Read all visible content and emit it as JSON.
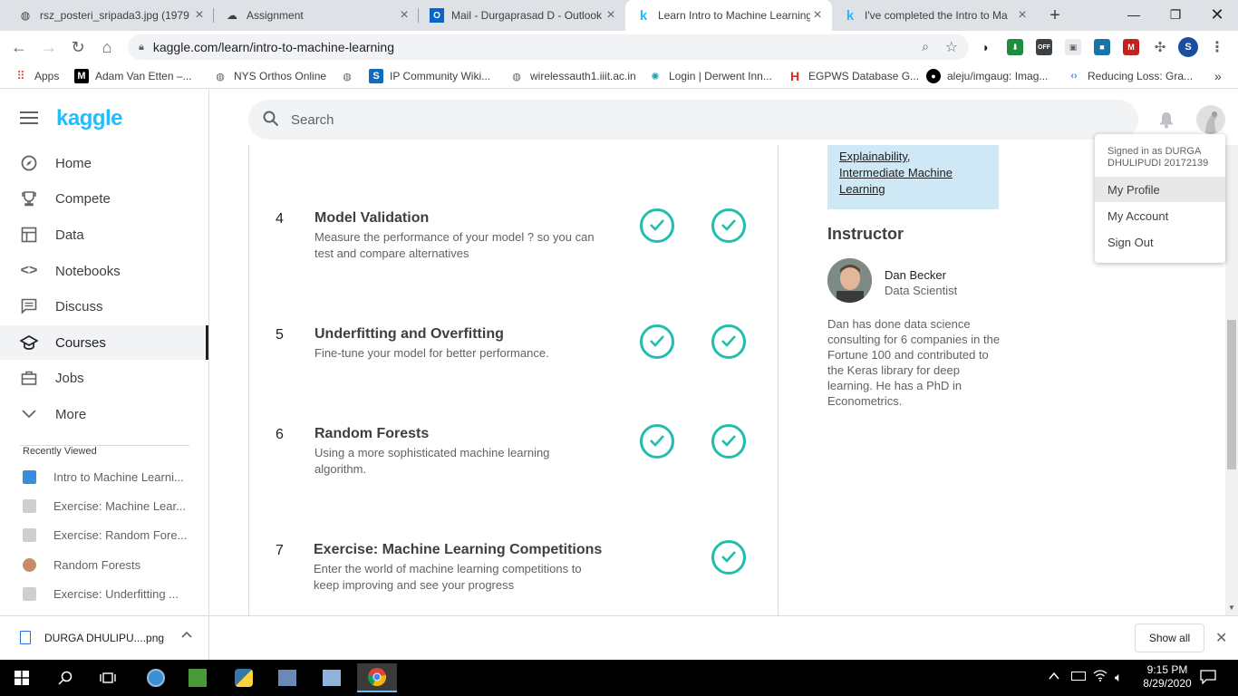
{
  "browser": {
    "tabs": [
      {
        "title": "rsz_posteri_sripada3.jpg (1979",
        "icon": "globe-icon"
      },
      {
        "title": "Assignment",
        "icon": "cloud-icon"
      },
      {
        "title": "Mail - Durgaprasad D - Outlook",
        "icon": "outlook-icon"
      },
      {
        "title": "Learn Intro to Machine Learning",
        "icon": "kaggle-k-icon",
        "active": true
      },
      {
        "title": "I've completed the Intro to Ma",
        "icon": "kaggle-k-icon"
      }
    ],
    "new_tab": "+",
    "url": "kaggle.com/learn/intro-to-machine-learning",
    "profile_initial": "S",
    "bookmarks": [
      {
        "label": "Apps"
      },
      {
        "label": "Adam Van Etten –..."
      },
      {
        "label": "NYS Orthos Online"
      },
      {
        "label": ""
      },
      {
        "label": "IP Community Wiki..."
      },
      {
        "label": "wirelessauth1.iiit.ac.in"
      },
      {
        "label": "Login | Derwent Inn..."
      },
      {
        "label": "EGPWS Database G..."
      },
      {
        "label": "aleju/imgaug: Imag..."
      },
      {
        "label": "Reducing Loss: Gra..."
      }
    ],
    "bookmarks_more": "»"
  },
  "kaggle": {
    "logo": "kaggle",
    "search_placeholder": "Search",
    "nav": [
      {
        "label": "Home",
        "icon": "compass-icon"
      },
      {
        "label": "Compete",
        "icon": "trophy-icon"
      },
      {
        "label": "Data",
        "icon": "table-icon"
      },
      {
        "label": "Notebooks",
        "icon": "code-icon"
      },
      {
        "label": "Discuss",
        "icon": "comment-icon"
      },
      {
        "label": "Courses",
        "icon": "graduation-cap-icon",
        "active": true
      },
      {
        "label": "Jobs",
        "icon": "briefcase-icon"
      },
      {
        "label": "More",
        "icon": "chevron-down-icon"
      }
    ],
    "recently_viewed_title": "Recently Viewed",
    "recently_viewed": [
      "Intro to Machine Learni...",
      "Exercise: Machine Lear...",
      "Exercise: Random Fore...",
      "Random Forests",
      "Exercise: Underfitting ..."
    ],
    "lessons": [
      {
        "num": "4",
        "title": "Model Validation",
        "desc": "Measure the performance of your model ? so you can test and compare alternatives",
        "tutorial_done": true,
        "exercise_done": true
      },
      {
        "num": "5",
        "title": "Underfitting and Overfitting",
        "desc": "Fine-tune your model for better performance.",
        "tutorial_done": true,
        "exercise_done": true
      },
      {
        "num": "6",
        "title": "Random Forests",
        "desc": "Using a more sophisticated machine learning algorithm.",
        "tutorial_done": true,
        "exercise_done": true
      },
      {
        "num": "7",
        "title": "Exercise: Machine Learning Competitions",
        "desc": "Enter the world of machine learning competitions to keep improving and see your progress",
        "tutorial_done": false,
        "exercise_done": true
      }
    ],
    "next_courses": [
      "Explainability,",
      "Intermediate Machine",
      "Learning"
    ],
    "instructor_heading": "Instructor",
    "instructor": {
      "name": "Dan Becker",
      "role": "Data Scientist",
      "bio": "Dan has done data science consulting for 6 companies in the Fortune 100 and contributed to the Keras library for deep learning. He has a PhD in Econometrics."
    },
    "profile_menu": {
      "signed_in_as": "Signed in as DURGA DHULIPUDI 20172139",
      "items": [
        "My Profile",
        "My Account",
        "Sign Out"
      ]
    }
  },
  "downloads": {
    "file": "DURGA DHULIPU....png",
    "show_all": "Show all"
  },
  "taskbar": {
    "time": "9:15 PM",
    "date": "8/29/2020"
  },
  "colors": {
    "kaggle_blue": "#20beff",
    "check_teal": "#20beab"
  }
}
